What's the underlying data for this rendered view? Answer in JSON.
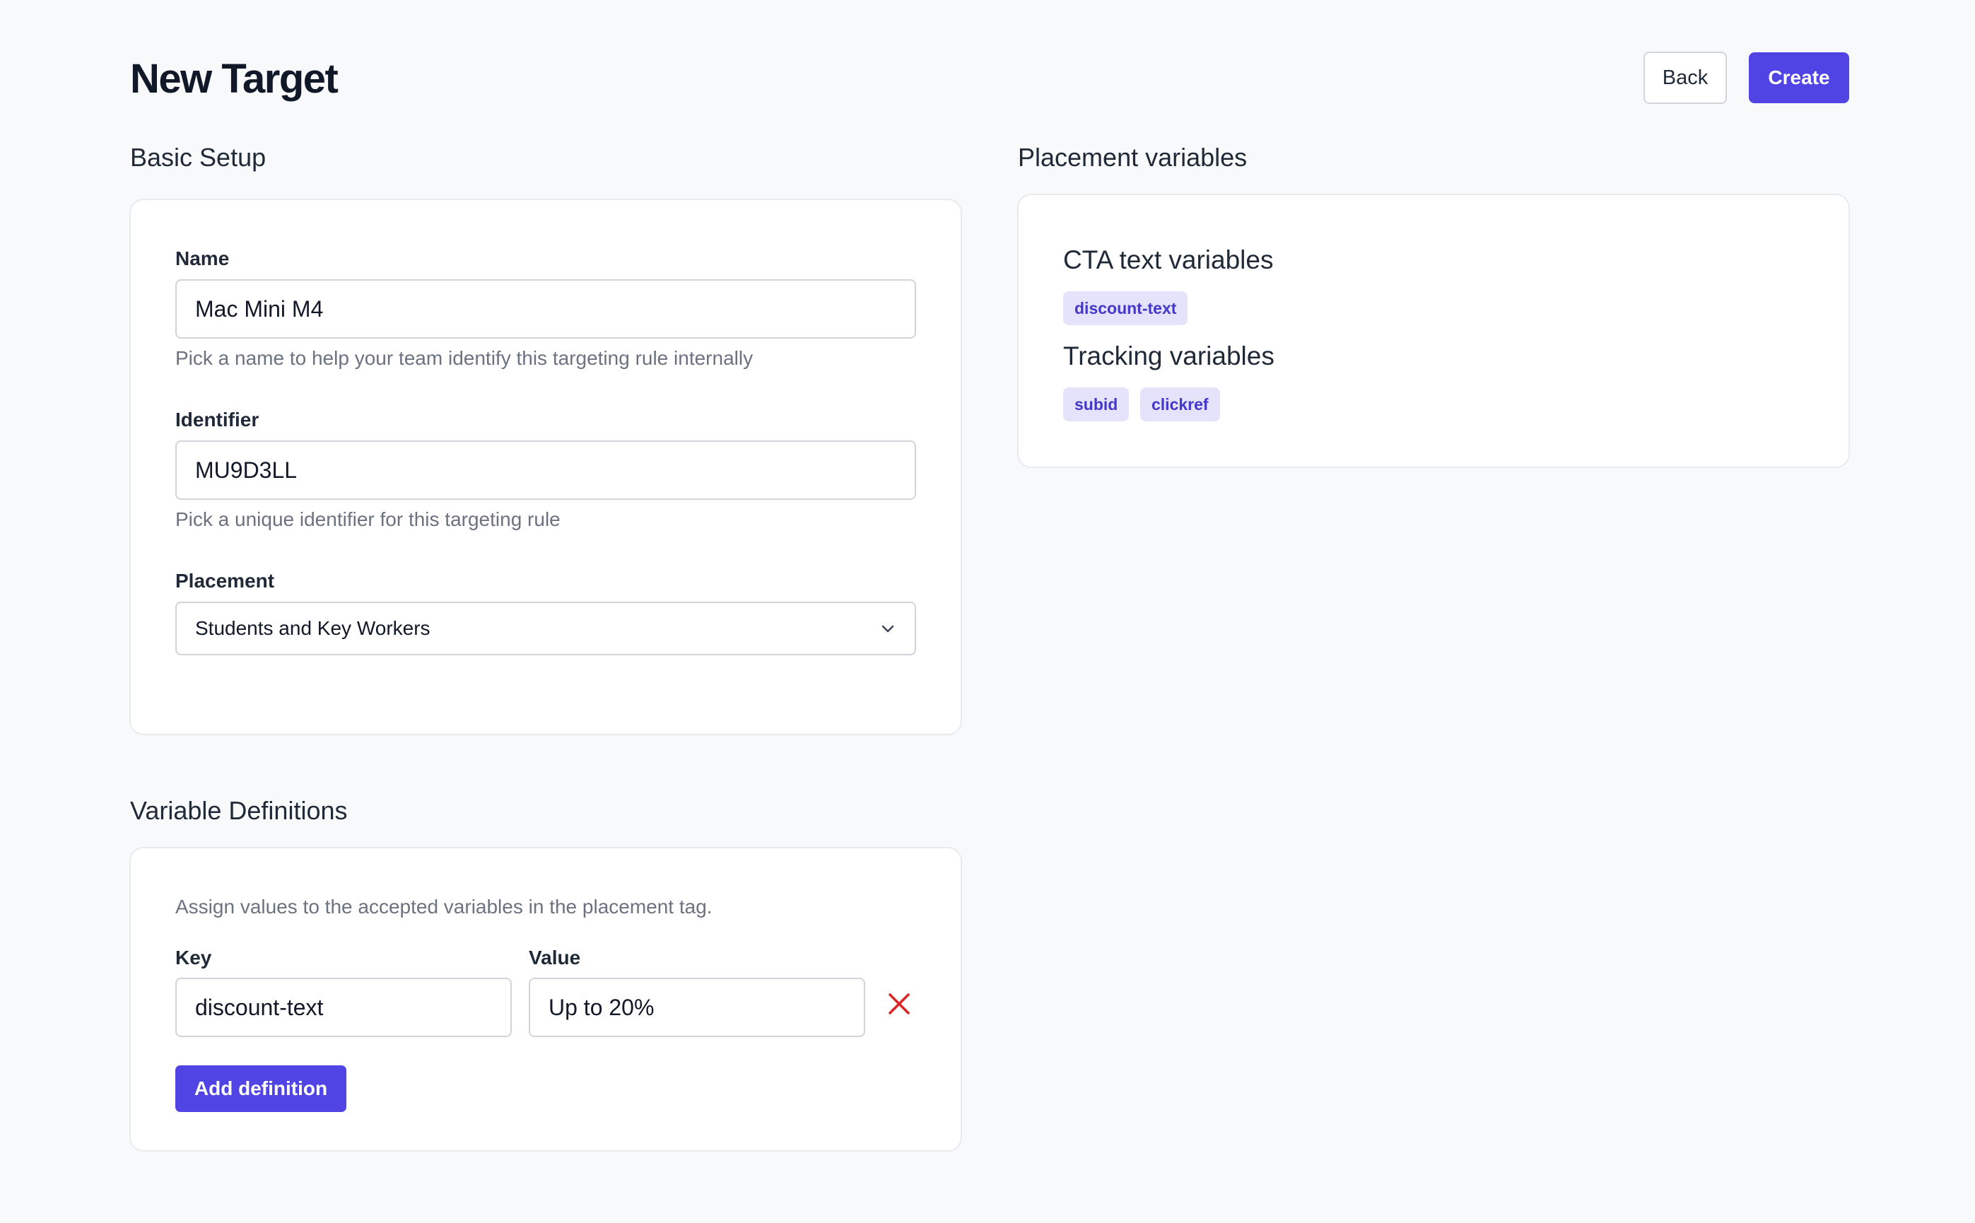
{
  "header": {
    "title": "New Target",
    "back_label": "Back",
    "create_label": "Create"
  },
  "basic_setup": {
    "title": "Basic Setup",
    "name": {
      "label": "Name",
      "value": "Mac Mini M4",
      "help": "Pick a name to help your team identify this targeting rule internally"
    },
    "identifier": {
      "label": "Identifier",
      "value": "MU9D3LL",
      "help": "Pick a unique identifier for this targeting rule"
    },
    "placement": {
      "label": "Placement",
      "selected": "Students and Key Workers"
    }
  },
  "variable_definitions": {
    "title": "Variable Definitions",
    "description": "Assign values to the accepted variables in the placement tag.",
    "key_label": "Key",
    "value_label": "Value",
    "rows": [
      {
        "key": "discount-text",
        "value": "Up to 20%"
      }
    ],
    "add_label": "Add definition"
  },
  "placement_variables": {
    "title": "Placement variables",
    "cta_heading": "CTA text variables",
    "cta_tags": [
      "discount-text"
    ],
    "tracking_heading": "Tracking variables",
    "tracking_tags": [
      "subid",
      "clickref"
    ]
  },
  "icons": {
    "chevron": "chevron-down-icon",
    "remove": "close-icon"
  },
  "colors": {
    "accent": "#5144e5",
    "tag_bg": "#e4e3fb",
    "tag_text": "#4338ca",
    "danger": "#dc2626",
    "page_bg": "#f8f9fb"
  }
}
